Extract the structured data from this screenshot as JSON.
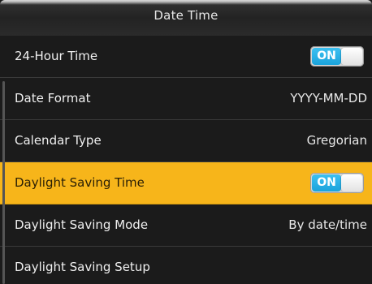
{
  "screen": {
    "title": "Date Time"
  },
  "menu": {
    "items": [
      {
        "label": "24-Hour Time",
        "toggle": "ON"
      },
      {
        "label": "Date Format",
        "value": "YYYY-MM-DD"
      },
      {
        "label": "Calendar Type",
        "value": "Gregorian"
      },
      {
        "label": "Daylight Saving Time",
        "toggle": "ON"
      },
      {
        "label": "Daylight Saving Mode",
        "value": "By date/time"
      },
      {
        "label": "Daylight Saving Setup"
      }
    ],
    "selected_index": 3
  },
  "colors": {
    "selected_row": "#f7b51a",
    "toggle_on": "#1aa3dc"
  }
}
